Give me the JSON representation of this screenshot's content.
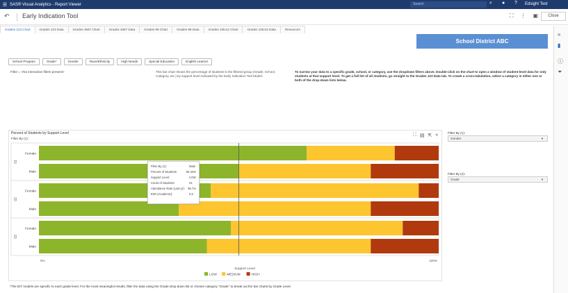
{
  "app": {
    "title": "SAS® Visual Analytics - Report Viewer",
    "search_placeholder": "Search",
    "user": "Edsight Test"
  },
  "report": {
    "title": "Early Indication Tool",
    "close_label": "Close"
  },
  "tabs": [
    {
      "label": "Grades 123 Chart",
      "active": true
    },
    {
      "label": "Grades 123 Data"
    },
    {
      "label": "Grades 4567 Chart"
    },
    {
      "label": "Grades 4567 Data"
    },
    {
      "label": "Grades 89 Chart"
    },
    {
      "label": "Grades 89 Data"
    },
    {
      "label": "Grades 10to12 Chart"
    },
    {
      "label": "Grades 10to12 Data"
    },
    {
      "label": "Resources"
    }
  ],
  "district_banner": "School District ABC",
  "filter_buttons": [
    "School Program",
    "Grade*",
    "Gender",
    "Race/Ethnicity",
    "High Needs",
    "Special Education",
    "English Learner"
  ],
  "filter_text": "Filter = <No interactive filters present>",
  "description": "This bar chart shows the percentage of students in the filtered group (Grade, School, Category, etc.) by support level indicated by the Early Indication Tool Model.",
  "instructions": "To narrow your data to a specific grade, school, or category, use the dropdown filters above. Double-click on the chart to open a window of student-level data for only students at that support level. To get a full list of all students, go straight to the Grades 123 Data tab. To create a cross-tabulation, select a category in either one or both of the drop-down lists below.",
  "side_filters": {
    "filter1_label": "Filter By (1):",
    "filter1_value": "Gender",
    "filter2_label": "Filter By (2):",
    "filter2_value": "Grade"
  },
  "footnote": "*The EIT models are specific to each grade level. For the most meaningful results, filter the data using the Grade drop-down list or choose category \"Grade\" to break out the bar charts by Grade Level.",
  "tooltip": [
    {
      "key": "Filter By (1):",
      "value": "Male"
    },
    {
      "key": "Percent of Students:",
      "value": "56.44%"
    },
    {
      "key": "Support Level:",
      "value": "LOW"
    },
    {
      "key": "Count of Students:",
      "value": "31"
    },
    {
      "key": "Attendance Rate (Last yr):",
      "value": "96.7%"
    },
    {
      "key": "EWI (Academic):",
      "value": "0.6"
    }
  ],
  "chart_data": {
    "type": "bar",
    "orientation": "horizontal",
    "stacked": true,
    "title": "Percent of Students by Support Level",
    "subtitle": "Filter By (1):",
    "xlabel": "Support Level",
    "xlim": [
      0,
      100
    ],
    "xticks": [
      "0%",
      "100%"
    ],
    "reference_line_at": 50,
    "legend_position": "bottom",
    "groups": [
      {
        "label": "01",
        "rows": [
          {
            "label": "Female",
            "values": [
              67,
              22,
              11
            ]
          },
          {
            "label": "Male",
            "values": [
              50,
              33,
              17
            ]
          }
        ]
      },
      {
        "label": "02",
        "rows": [
          {
            "label": "Female",
            "values": [
              43,
              52,
              5
            ]
          },
          {
            "label": "Male",
            "values": [
              35,
              48,
              17
            ]
          }
        ]
      },
      {
        "label": "03",
        "rows": [
          {
            "label": "Female",
            "values": [
              48,
              43,
              9
            ]
          },
          {
            "label": "Male",
            "values": [
              42,
              41,
              17
            ]
          }
        ]
      }
    ],
    "series": [
      {
        "name": "LOW",
        "color": "#8db52c"
      },
      {
        "name": "MEDIUM",
        "color": "#fdc52f"
      },
      {
        "name": "HIGH",
        "color": "#b03a0e"
      }
    ]
  }
}
